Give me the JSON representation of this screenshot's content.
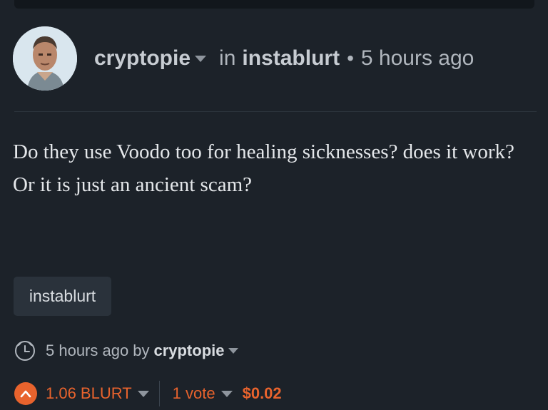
{
  "post": {
    "author": "cryptopie",
    "in_word": "in",
    "community": "instablurt",
    "separator_dot": "•",
    "time_ago": "5 hours ago",
    "body": "Do they use Voodo too for healing sicknesses? does it work? Or it is just an ancient scam?"
  },
  "tags": [
    "instablurt"
  ],
  "footer": {
    "time_ago": "5 hours ago",
    "by_word": "by",
    "author": "cryptopie"
  },
  "votes": {
    "payout": "1.06 BLURT",
    "count_label": "1 vote",
    "value": "$0.02"
  },
  "icons": {
    "avatar": "avatar-image",
    "author_menu": "chevron-down-icon",
    "clock": "clock-icon",
    "upvote": "upvote-icon"
  },
  "colors": {
    "background": "#1c2229",
    "accent": "#e8632d",
    "tag_bg": "#2a323b"
  }
}
